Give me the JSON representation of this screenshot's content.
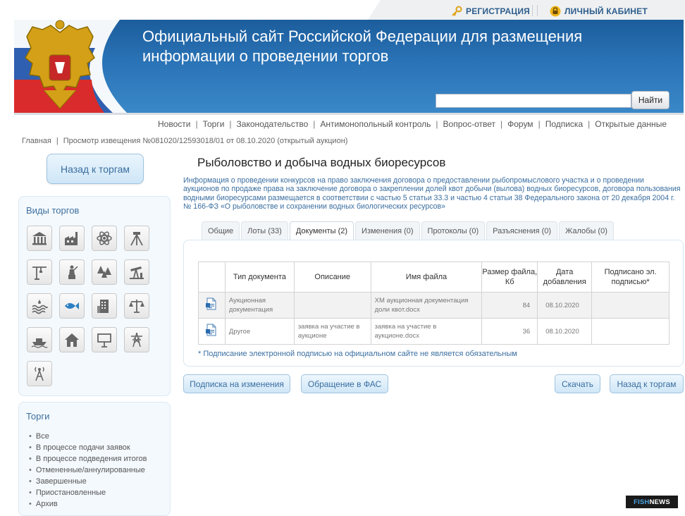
{
  "header": {
    "registration_label": "РЕГИСТРАЦИЯ",
    "cabinet_label": "ЛИЧНЫЙ КАБИНЕТ",
    "site_title": "Официальный сайт Российской Федерации для размещения информации о проведении торгов",
    "search_placeholder": "",
    "search_button": "Найти"
  },
  "nav": {
    "items": [
      "Новости",
      "Торги",
      "Законодательство",
      "Антимонопольный контроль",
      "Вопрос-ответ",
      "Форум",
      "Подписка",
      "Открытые данные"
    ],
    "separator": "|"
  },
  "breadcrumb": {
    "home": "Главная",
    "separator": "|",
    "current": "Просмотр извещения №081020/12593018/01 от 08.10.2020 (открытый аукцион)"
  },
  "sidebar": {
    "back_button": "Назад к торгам",
    "types_title": "Виды торгов",
    "type_icons": [
      "museum-icon",
      "factory-icon",
      "atom-icon",
      "survey-tripod-icon",
      "crane-icon",
      "statue-icon",
      "forest-icon",
      "oil-pump-icon",
      "water-icon",
      "fish-icon",
      "building-icon",
      "scales-icon",
      "boat-icon",
      "house-icon",
      "billboard-icon",
      "power-tower-icon",
      "antenna-icon"
    ],
    "torgi_title": "Торги",
    "torgi_items": [
      "Все",
      "В процессе подачи заявок",
      "В процессе подведения итогов",
      "Отмененные/аннулированные",
      "Завершенные",
      "Приостановленные",
      "Архив"
    ]
  },
  "main": {
    "title": "Рыболовство и добыча водных биоресурсов",
    "description": "Информация о проведении конкурсов на право заключения договора о предоставлении рыбопромыслового участка и о проведении аукционов по продаже права на заключение договора о закреплении долей квот добычи (вылова) водных биоресурсов, договора пользования водными биоресурсами размещается в соответствии с частью 5 статьи 33.3 и частью 4 статьи 38 Федерального закона от 20 декабря 2004 г. № 166-ФЗ «О рыболовстве и сохранении водных биологических ресурсов»",
    "tabs": [
      "Общие",
      "Лоты (33)",
      "Документы (2)",
      "Изменения (0)",
      "Протоколы (0)",
      "Разъяснения (0)",
      "Жалобы (0)"
    ],
    "active_tab": "Документы (2)",
    "table": {
      "headers": [
        "",
        "Тип документа",
        "Описание",
        "Имя файла",
        "Размер файла, Кб",
        "Дата добавления",
        "Подписано эл. подписью*"
      ],
      "rows": [
        {
          "type": "Аукционная документация",
          "description": "",
          "filename": "ХМ аукционная документация доли квот.docx",
          "size": "84",
          "date": "08.10.2020",
          "signed": ""
        },
        {
          "type": "Другое",
          "description": "заявка на участие в аукционе",
          "filename": "заявка на участие в аукционе.docx",
          "size": "36",
          "date": "08.10.2020",
          "signed": ""
        }
      ]
    },
    "note": "* Подписание электронной подписью на официальном сайте не является обязательным",
    "buttons": {
      "subscribe": "Подписка на изменения",
      "fas": "Обращение в ФАС",
      "download": "Скачать",
      "back": "Назад к торгам"
    }
  },
  "watermark": {
    "fish": "FISH",
    "news": "NEWS"
  },
  "colors": {
    "link_blue": "#3a6ea0",
    "banner_blue": "#2a73b6",
    "top_link": "#2e5e8c"
  }
}
